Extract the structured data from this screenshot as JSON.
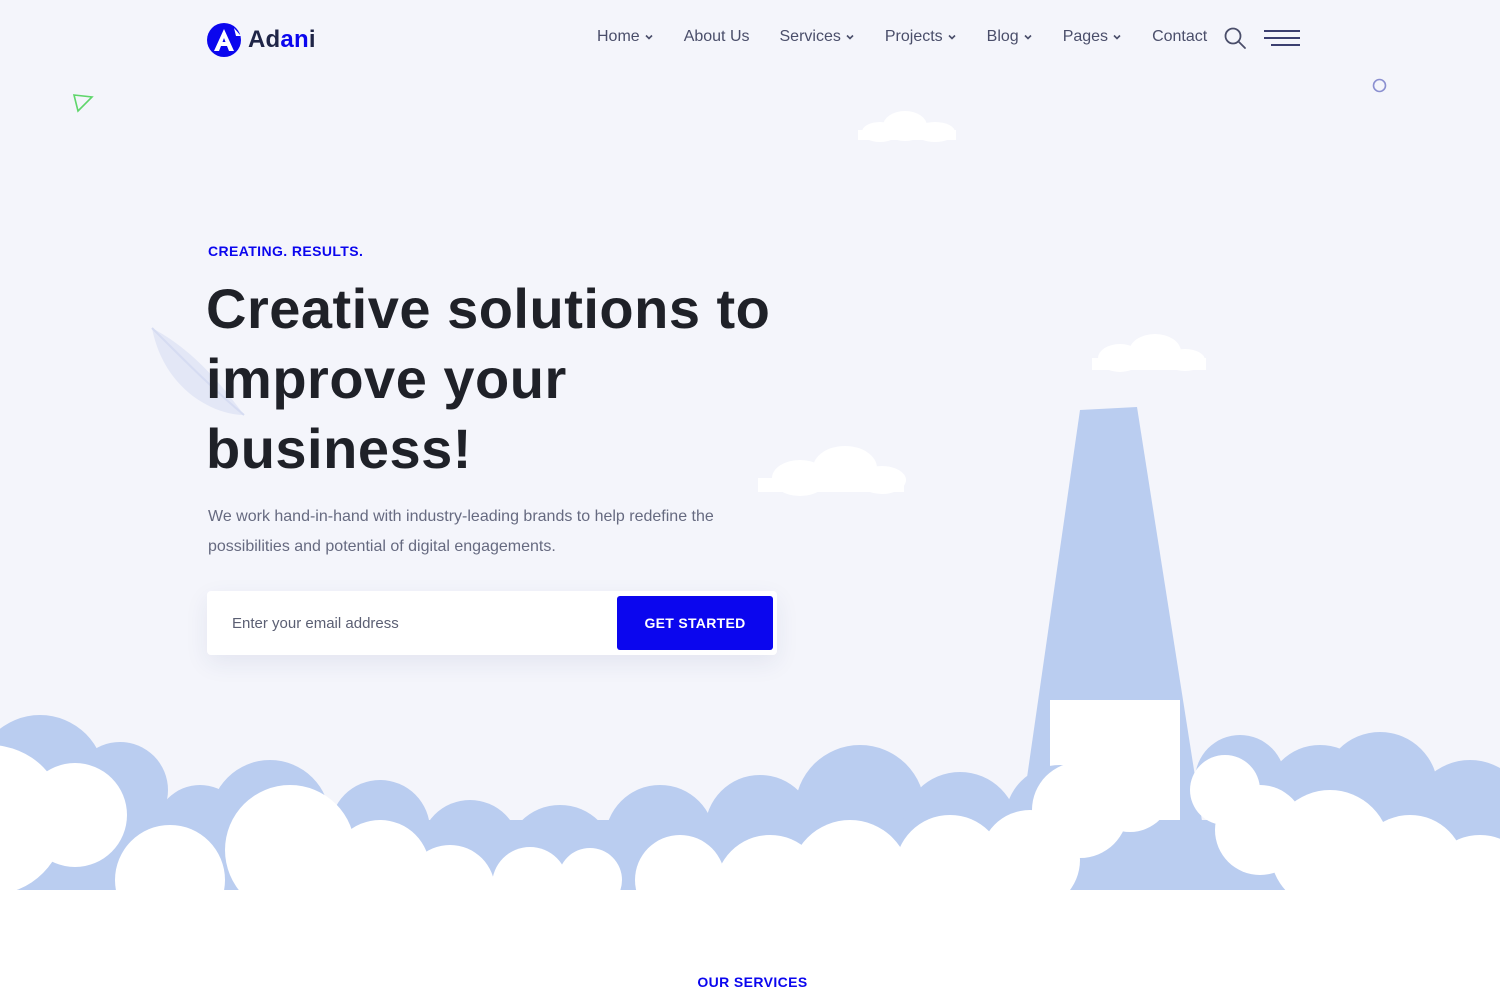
{
  "brand": {
    "name_prefix": "Ad",
    "name_accent": "an",
    "name_suffix": "i",
    "logo_icon": "letter-a-logo-icon",
    "accent_color": "#0b06ee"
  },
  "nav": {
    "items": [
      {
        "label": "Home",
        "has_dropdown": true
      },
      {
        "label": "About Us",
        "has_dropdown": false
      },
      {
        "label": "Services",
        "has_dropdown": true
      },
      {
        "label": "Projects",
        "has_dropdown": true
      },
      {
        "label": "Blog",
        "has_dropdown": true
      },
      {
        "label": "Pages",
        "has_dropdown": true
      },
      {
        "label": "Contact",
        "has_dropdown": false
      }
    ],
    "search_icon": "search-icon",
    "menu_icon": "hamburger-menu-icon"
  },
  "hero": {
    "tagline": "CREATING. RESULTS.",
    "title_line1": "Creative solutions to",
    "title_line2": "improve your",
    "title_line3": "business!",
    "description": "We work hand-in-hand with industry-leading brands to help redefine the possibilities and potential of digital engagements.",
    "email_placeholder": "Enter your email address",
    "email_value": "",
    "cta_label": "GET STARTED"
  },
  "colors": {
    "background": "#f4f5fb",
    "cloud_blue": "#bacdf0",
    "cloud_white": "#ffffff",
    "heading": "#1f2128",
    "body_text": "#666a80"
  },
  "sections": {
    "next_label": "OUR SERVICES"
  }
}
